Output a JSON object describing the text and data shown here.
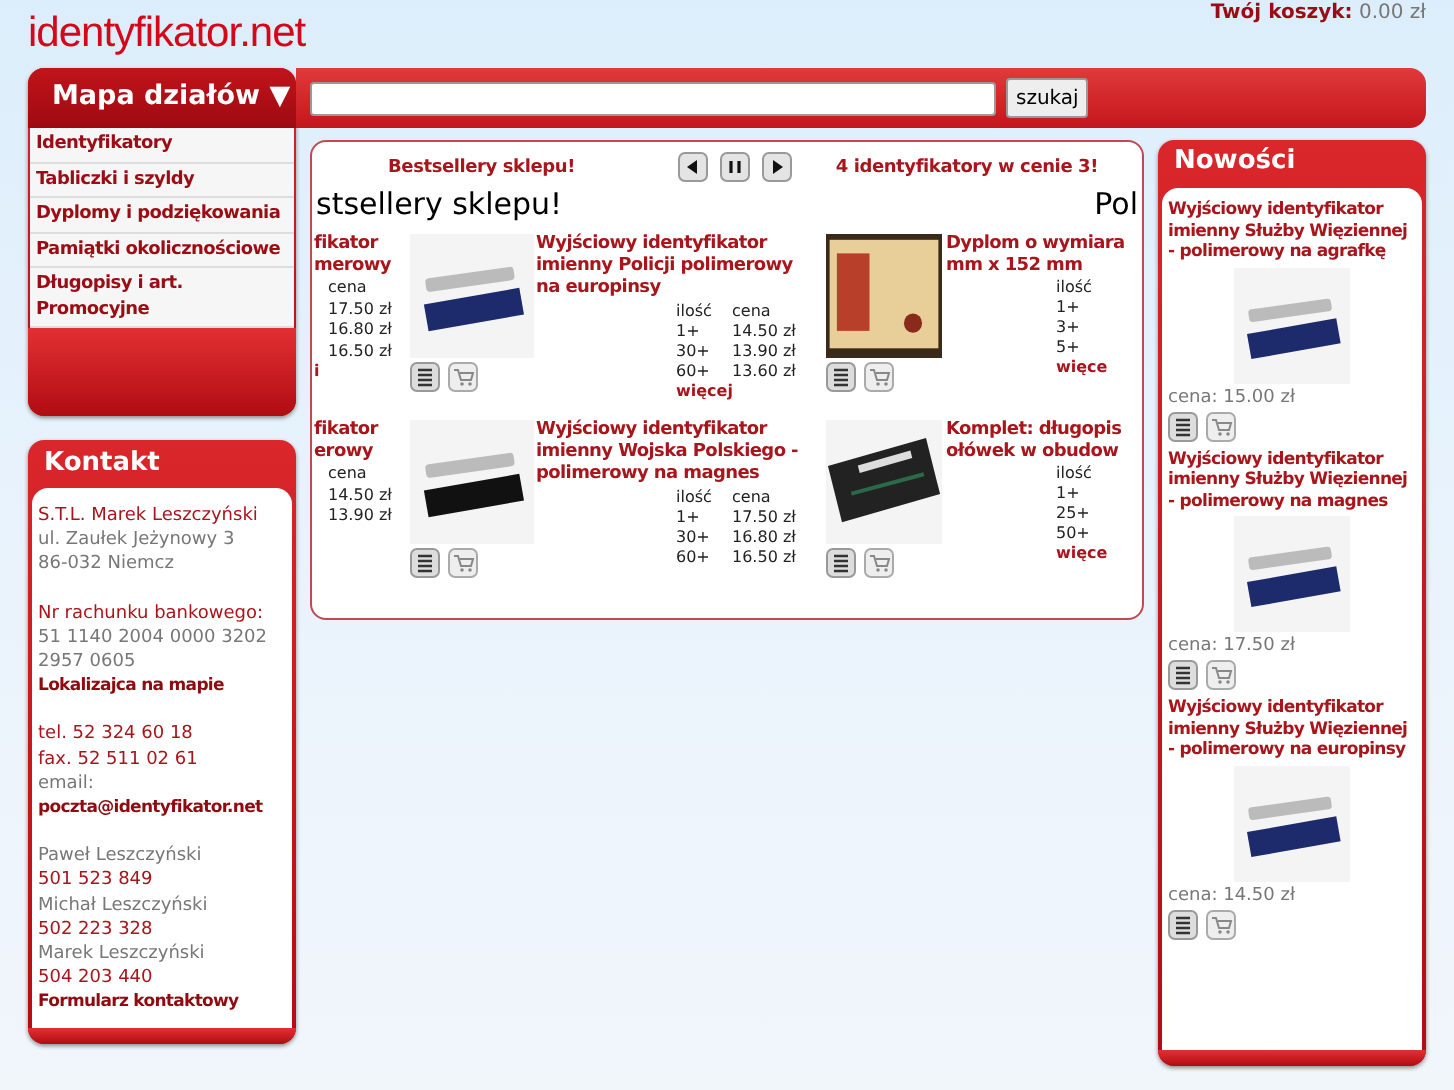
{
  "logo": "identyfikator.net",
  "cart": {
    "label": "Twój koszyk:",
    "value": "0.00 zł"
  },
  "menu": {
    "title": "Mapa działów ▼",
    "items": [
      "Identyfikatory",
      "Tabliczki i szyldy",
      "Dyplomy i podziękowania",
      "Pamiątki okolicznościowe",
      "Długopisy i art. Promocyjne"
    ]
  },
  "search": {
    "button": "szukaj"
  },
  "contact": {
    "title": "Kontakt",
    "lines": [
      {
        "kind": "red",
        "text": "S.T.L. Marek Leszczyński"
      },
      {
        "kind": "grey",
        "text": "ul. Zaułek Jeżynowy 3"
      },
      {
        "kind": "grey",
        "text": "86-032 Niemcz"
      },
      {
        "kind": "gap"
      },
      {
        "kind": "red",
        "text": "Nr rachunku bankowego:"
      },
      {
        "kind": "grey",
        "text": "51 1140 2004 0000 3202 2957 0605"
      },
      {
        "kind": "link",
        "text": "Lokalizajca na mapie"
      },
      {
        "kind": "gap"
      },
      {
        "kind": "red",
        "text": "tel. 52 324 60 18"
      },
      {
        "kind": "red",
        "text": "fax. 52 511 02 61"
      },
      {
        "kind": "grey",
        "text": "email:"
      },
      {
        "kind": "link",
        "text": "poczta@identyfikator.net"
      },
      {
        "kind": "gap"
      },
      {
        "kind": "grey",
        "text": "Paweł Leszczyński"
      },
      {
        "kind": "red",
        "text": "501 523 849"
      },
      {
        "kind": "grey",
        "text": "Michał Leszczyński"
      },
      {
        "kind": "red",
        "text": "502 223 328"
      },
      {
        "kind": "grey",
        "text": "Marek Leszczyński"
      },
      {
        "kind": "red",
        "text": "504 203 440"
      },
      {
        "kind": "link",
        "text": "Formularz kontaktowy"
      }
    ]
  },
  "carousel": {
    "tabs": [
      "Bestsellery sklepu!",
      "4 identyfikatory w cenie 3!"
    ],
    "heading_left": "stsellery sklepu!",
    "heading_right": "Pol",
    "left_items": [
      {
        "title": [
          "fikator",
          "merowy"
        ],
        "price_head": "cena",
        "prices": [
          "17.50 zł",
          "16.80 zł",
          "16.50 zł"
        ],
        "more": "i"
      },
      {
        "title": [
          "fikator",
          "erowy"
        ],
        "price_head": "cena",
        "prices": [
          "14.50 zł",
          "13.90 zł"
        ]
      }
    ],
    "items": [
      {
        "title": "Wyjściowy identyfikator imienny Policji polimerowy na europinsy",
        "qty_head": "ilość",
        "price_head": "cena",
        "rows": [
          [
            "1+",
            "14.50 zł"
          ],
          [
            "30+",
            "13.90 zł"
          ],
          [
            "60+",
            "13.60 zł"
          ]
        ],
        "more": "więcej"
      },
      {
        "title": "Wyjściowy identyfikator imienny Wojska Polskiego - polimerowy na magnes",
        "qty_head": "ilość",
        "price_head": "cena",
        "rows": [
          [
            "1+",
            "17.50 zł"
          ],
          [
            "30+",
            "16.80 zł"
          ],
          [
            "60+",
            "16.50 zł"
          ]
        ]
      }
    ],
    "right_items": [
      {
        "kind": "diploma",
        "title": [
          "Dyplom o wymiara",
          "mm x 152 mm"
        ],
        "qty_head": "ilość",
        "qtys": [
          "1+",
          "3+",
          "5+"
        ],
        "more": "więce"
      },
      {
        "kind": "pens",
        "title": [
          "Komplet: długopis",
          "ołówek w obudow"
        ],
        "qty_head": "ilość",
        "qtys": [
          "1+",
          "25+",
          "50+"
        ],
        "more": "więce"
      }
    ]
  },
  "news": {
    "title": "Nowości",
    "items": [
      {
        "title": "Wyjściowy identyfikator imienny Służby Więziennej - polimerowy na agrafkę",
        "price": "cena: 15.00 zł"
      },
      {
        "title": "Wyjściowy identyfikator imienny Służby Więziennej - polimerowy na magnes",
        "price": "cena: 17.50 zł"
      },
      {
        "title": "Wyjściowy identyfikator imienny Służby Więziennej - polimerowy na europinsy",
        "price": "cena: 14.50 zł"
      }
    ]
  }
}
